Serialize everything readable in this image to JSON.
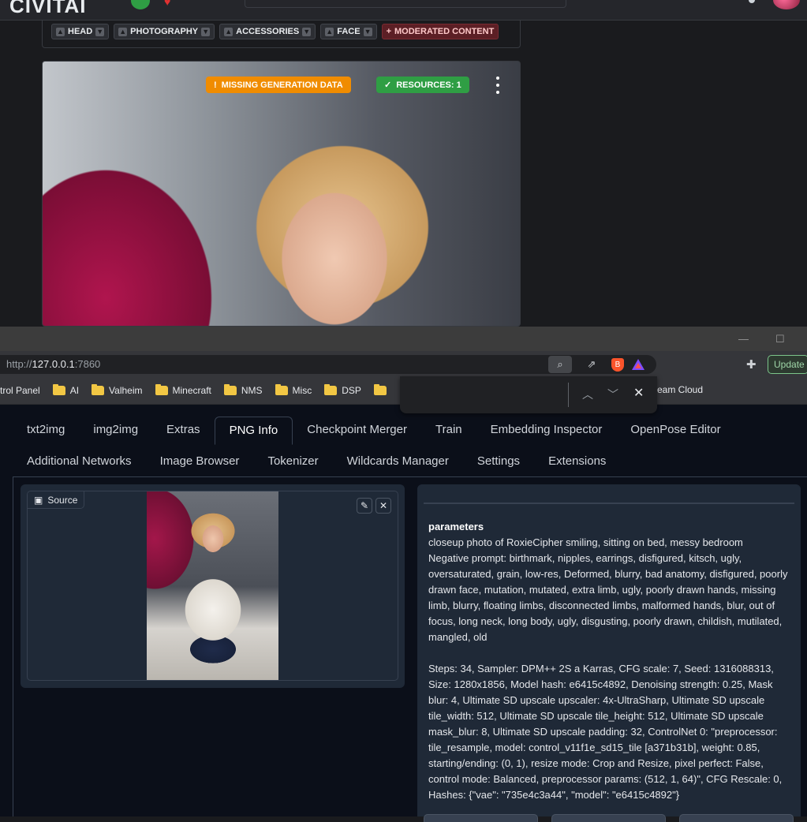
{
  "site": {
    "tags": [
      {
        "label": "HEAD"
      },
      {
        "label": "PHOTOGRAPHY"
      },
      {
        "label": "ACCESSORIES"
      },
      {
        "label": "FACE"
      }
    ],
    "moderated_label": "MODERATED CONTENT",
    "badge_warning": "MISSING GENERATION DATA",
    "badge_resources": "RESOURCES: 1"
  },
  "browser": {
    "url_scheme": "http://",
    "url_host": "127.0.0.1",
    "url_port": ":7860",
    "update_label": "Update",
    "bookmarks": [
      {
        "label": "trol Panel",
        "folder": false
      },
      {
        "label": "AI",
        "folder": true
      },
      {
        "label": "Valheim",
        "folder": true
      },
      {
        "label": "Minecraft",
        "folder": true
      },
      {
        "label": "NMS",
        "folder": true
      },
      {
        "label": "Misc",
        "folder": true
      },
      {
        "label": "DSP",
        "folder": true
      }
    ],
    "bookmark_partial": "eam Cloud"
  },
  "app": {
    "tabs_row1": [
      "txt2img",
      "img2img",
      "Extras",
      "PNG Info",
      "Checkpoint Merger",
      "Train",
      "Embedding Inspector",
      "OpenPose Editor"
    ],
    "tabs_row2": [
      "Additional Networks",
      "Image Browser",
      "Tokenizer",
      "Wildcards Manager",
      "Settings",
      "Extensions"
    ],
    "selected_tab": "PNG Info",
    "source_label": "Source",
    "params_heading": "parameters",
    "prompt": "closeup photo of RoxieCipher smiling, sitting on bed, messy bedroom",
    "negative_prompt": "Negative prompt: birthmark, nipples, earrings, disfigured, kitsch, ugly, oversaturated, grain, low-res, Deformed, blurry, bad anatomy, disfigured, poorly drawn face, mutation, mutated, extra limb, ugly, poorly drawn hands, missing limb, blurry, floating limbs, disconnected limbs, malformed hands, blur, out of focus, long neck, long body, ugly, disgusting, poorly drawn, childish, mutilated, mangled, old",
    "settings": "Steps: 34, Sampler: DPM++ 2S a Karras, CFG scale: 7, Seed: 1316088313, Size: 1280x1856, Model hash: e6415c4892, Denoising strength: 0.25, Mask blur: 4, Ultimate SD upscale upscaler: 4x-UltraSharp, Ultimate SD upscale tile_width: 512, Ultimate SD upscale tile_height: 512, Ultimate SD upscale mask_blur: 8, Ultimate SD upscale padding: 32, ControlNet 0: \"preprocessor: tile_resample, model: control_v11f1e_sd15_tile [a371b31b], weight: 0.85, starting/ending: (0, 1), resize mode: Crop and Resize, pixel perfect: False, control mode: Balanced, preprocessor params: (512, 1, 64)\", CFG Rescale: 0, Hashes: {\"vae\": \"735e4c3a44\", \"model\": \"e6415c4892\"}"
  },
  "colors": {
    "badge_warning": "#f08c00",
    "badge_success": "#2f9e44",
    "gradio_bg": "#0b0f19",
    "gradio_block": "#1f2937"
  }
}
